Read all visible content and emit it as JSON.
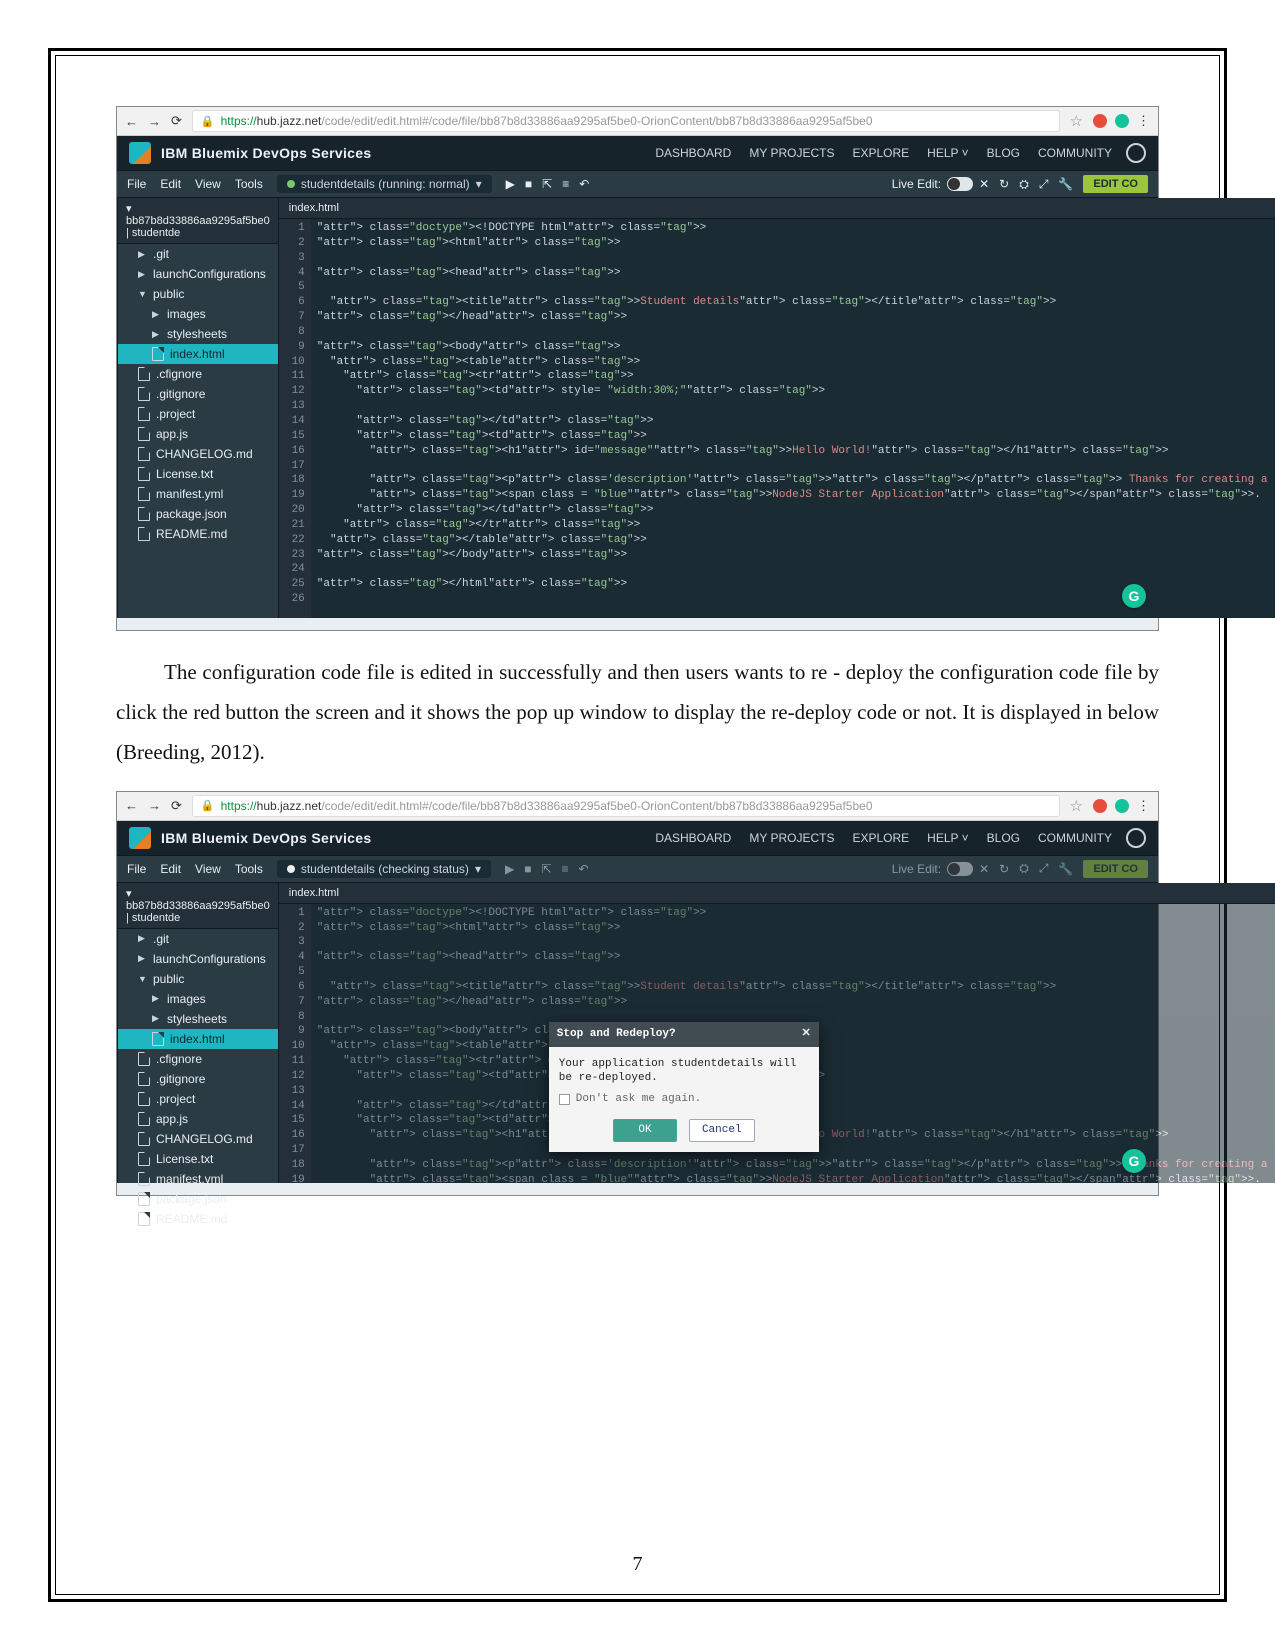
{
  "page_number": "7",
  "paragraph": "The configuration code file is edited in successfully and then users wants to re - deploy the configuration code file by click the red button the screen and it shows the pop up window to display the re-deploy code or not. It is displayed in below (Breeding, 2012).",
  "url": {
    "scheme": "https://",
    "host": "hub.jazz.net",
    "path_dim": "/code/edit/edit.html#/code/file/bb87b8d33886aa9295af5be0-OrionContent/bb87b8d33886aa9295af5be0"
  },
  "brand_title": "IBM Bluemix DevOps Services",
  "topnav": {
    "dashboard": "DASHBOARD",
    "myprojects": "MY PROJECTS",
    "explore": "EXPLORE",
    "help": "HELP",
    "blog": "BLOG",
    "community": "COMMUNITY"
  },
  "menu": {
    "file": "File",
    "edit": "Edit",
    "view": "View",
    "tools": "Tools"
  },
  "run": {
    "label_running": "studentdetails (running: normal)",
    "label_checking": "studentdetails (checking status)"
  },
  "live_edit_label": "Live Edit:",
  "edit_button": "EDIT CO",
  "tree_header": "bb87b8d33886aa9295af5be0 | studentde",
  "tree": {
    "git": ".git",
    "launch": "launchConfigurations",
    "public": "public",
    "images": "images",
    "stylesheets": "stylesheets",
    "index": "index.html",
    "cfignore": ".cfignore",
    "gitignore": ".gitignore",
    "project": ".project",
    "appjs": "app.js",
    "changelog": "CHANGELOG.md",
    "license": "License.txt",
    "manifest": "manifest.yml",
    "package": "package.json",
    "readme": "README.md"
  },
  "editor_tab": "index.html",
  "code_lines": [
    "<!DOCTYPE html>",
    "<html>",
    "",
    "<head>",
    "",
    "  <title>Student details</title>",
    "</head>",
    "",
    "<body>",
    "  <table>",
    "    <tr>",
    "      <td style= \"width:30%;\">",
    "",
    "      </td>",
    "      <td>",
    "        <h1 id=\"message\">Hello World!</h1>",
    "",
    "        <p class='description'></p> Thanks for creating a  sample Application",
    "        <span class = \"blue\">NodeJS Starter Application</span>.",
    "      </td>",
    "    </tr>",
    "  </table>",
    "</body>",
    "",
    "</html>",
    ""
  ],
  "modal": {
    "title": "Stop and Redeploy?",
    "message": "Your application studentdetails will be re-deployed.",
    "dont_ask": "Don't ask me again.",
    "ok": "OK",
    "cancel": "Cancel"
  }
}
